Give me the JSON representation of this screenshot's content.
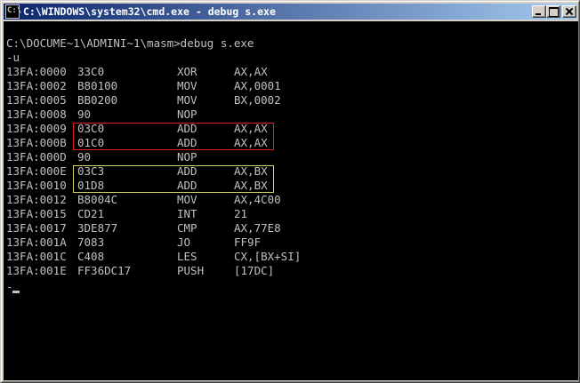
{
  "window": {
    "title": "C:\\WINDOWS\\system32\\cmd.exe - debug s.exe",
    "icon": "cmd-prompt-icon",
    "icon_glyph": "C:\\",
    "title_gradient": [
      "#0a246a",
      "#a6caf0"
    ],
    "controls": [
      "minimize",
      "maximize",
      "close"
    ]
  },
  "console": {
    "background": "#000000",
    "foreground": "#c0c0c0",
    "command_line": "C:\\DOCUME~1\\ADMINI~1\\masm>debug s.exe",
    "debug_command": "-u",
    "disassembly": [
      {
        "addr": "13FA:0000",
        "hex": "33C0",
        "mnemonic": "XOR",
        "operands": "AX,AX"
      },
      {
        "addr": "13FA:0002",
        "hex": "B80100",
        "mnemonic": "MOV",
        "operands": "AX,0001"
      },
      {
        "addr": "13FA:0005",
        "hex": "BB0200",
        "mnemonic": "MOV",
        "operands": "BX,0002"
      },
      {
        "addr": "13FA:0008",
        "hex": "90",
        "mnemonic": "NOP",
        "operands": ""
      },
      {
        "addr": "13FA:0009",
        "hex": "03C0",
        "mnemonic": "ADD",
        "operands": "AX,AX"
      },
      {
        "addr": "13FA:000B",
        "hex": "01C0",
        "mnemonic": "ADD",
        "operands": "AX,AX"
      },
      {
        "addr": "13FA:000D",
        "hex": "90",
        "mnemonic": "NOP",
        "operands": ""
      },
      {
        "addr": "13FA:000E",
        "hex": "03C3",
        "mnemonic": "ADD",
        "operands": "AX,BX"
      },
      {
        "addr": "13FA:0010",
        "hex": "01D8",
        "mnemonic": "ADD",
        "operands": "AX,BX"
      },
      {
        "addr": "13FA:0012",
        "hex": "B8004C",
        "mnemonic": "MOV",
        "operands": "AX,4C00"
      },
      {
        "addr": "13FA:0015",
        "hex": "CD21",
        "mnemonic": "INT",
        "operands": "21"
      },
      {
        "addr": "13FA:0017",
        "hex": "3DE877",
        "mnemonic": "CMP",
        "operands": "AX,77E8"
      },
      {
        "addr": "13FA:001A",
        "hex": "7083",
        "mnemonic": "JO",
        "operands": "FF9F"
      },
      {
        "addr": "13FA:001C",
        "hex": "C408",
        "mnemonic": "LES",
        "operands": "CX,[BX+SI]"
      },
      {
        "addr": "13FA:001E",
        "hex": "FF36DC17",
        "mnemonic": "PUSH",
        "operands": "[17DC]"
      }
    ],
    "prompt": "-",
    "highlights": [
      {
        "name": "red-box",
        "color": "#e02020",
        "rows": [
          "13FA:0009",
          "13FA:000B"
        ]
      },
      {
        "name": "yellow-box",
        "color": "#d8d860",
        "rows": [
          "13FA:000E",
          "13FA:0010"
        ]
      }
    ]
  }
}
